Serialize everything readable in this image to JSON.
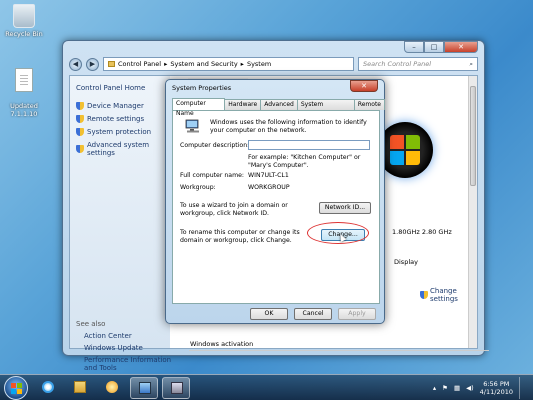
{
  "desktop": {
    "icons": [
      {
        "label": "Recycle Bin"
      },
      {
        "label": "Updated\n7.1.1.10"
      }
    ]
  },
  "window": {
    "controls": {
      "minimize": "–",
      "maximize": "□",
      "close": "✕"
    },
    "nav": {
      "back": "◀",
      "forward": "▶"
    },
    "breadcrumb": [
      "Control Panel",
      "System and Security",
      "System"
    ],
    "search_placeholder": "Search Control Panel",
    "left_pane": {
      "home": "Control Panel Home",
      "links": [
        "Device Manager",
        "Remote settings",
        "System protection",
        "Advanced system settings"
      ],
      "see_also": "See also",
      "see_also_links": [
        "Action Center",
        "Windows Update",
        "Performance Information and Tools"
      ]
    },
    "main": {
      "cpu_speed": "1.80GHz  2.80 GHz",
      "display_text": "Display",
      "change_settings": "Change settings",
      "activation": "Windows activation"
    }
  },
  "dialog": {
    "title": "System Properties",
    "close": "✕",
    "tabs": [
      "Computer Name",
      "Hardware",
      "Advanced",
      "System Protection",
      "Remote"
    ],
    "intro": "Windows uses the following information to identify your computer on the network.",
    "description_label": "Computer description:",
    "description_value": "",
    "example": "For example: \"Kitchen Computer\" or \"Mary's Computer\".",
    "full_name_label": "Full computer name:",
    "full_name_value": "WIN7ULT-CL1",
    "workgroup_label": "Workgroup:",
    "workgroup_value": "WORKGROUP",
    "wizard_text": "To use a wizard to join a domain or workgroup, click Network ID.",
    "network_id_button": "Network ID...",
    "rename_text": "To rename this computer or change its domain or workgroup, click Change.",
    "change_button": "Change...",
    "ok_button": "OK",
    "cancel_button": "Cancel",
    "apply_button": "Apply"
  },
  "taskbar": {
    "time": "6:56 PM",
    "date": "4/11/2010"
  },
  "colors": {
    "link": "#1e3b6d",
    "highlight": "#dd3333"
  }
}
